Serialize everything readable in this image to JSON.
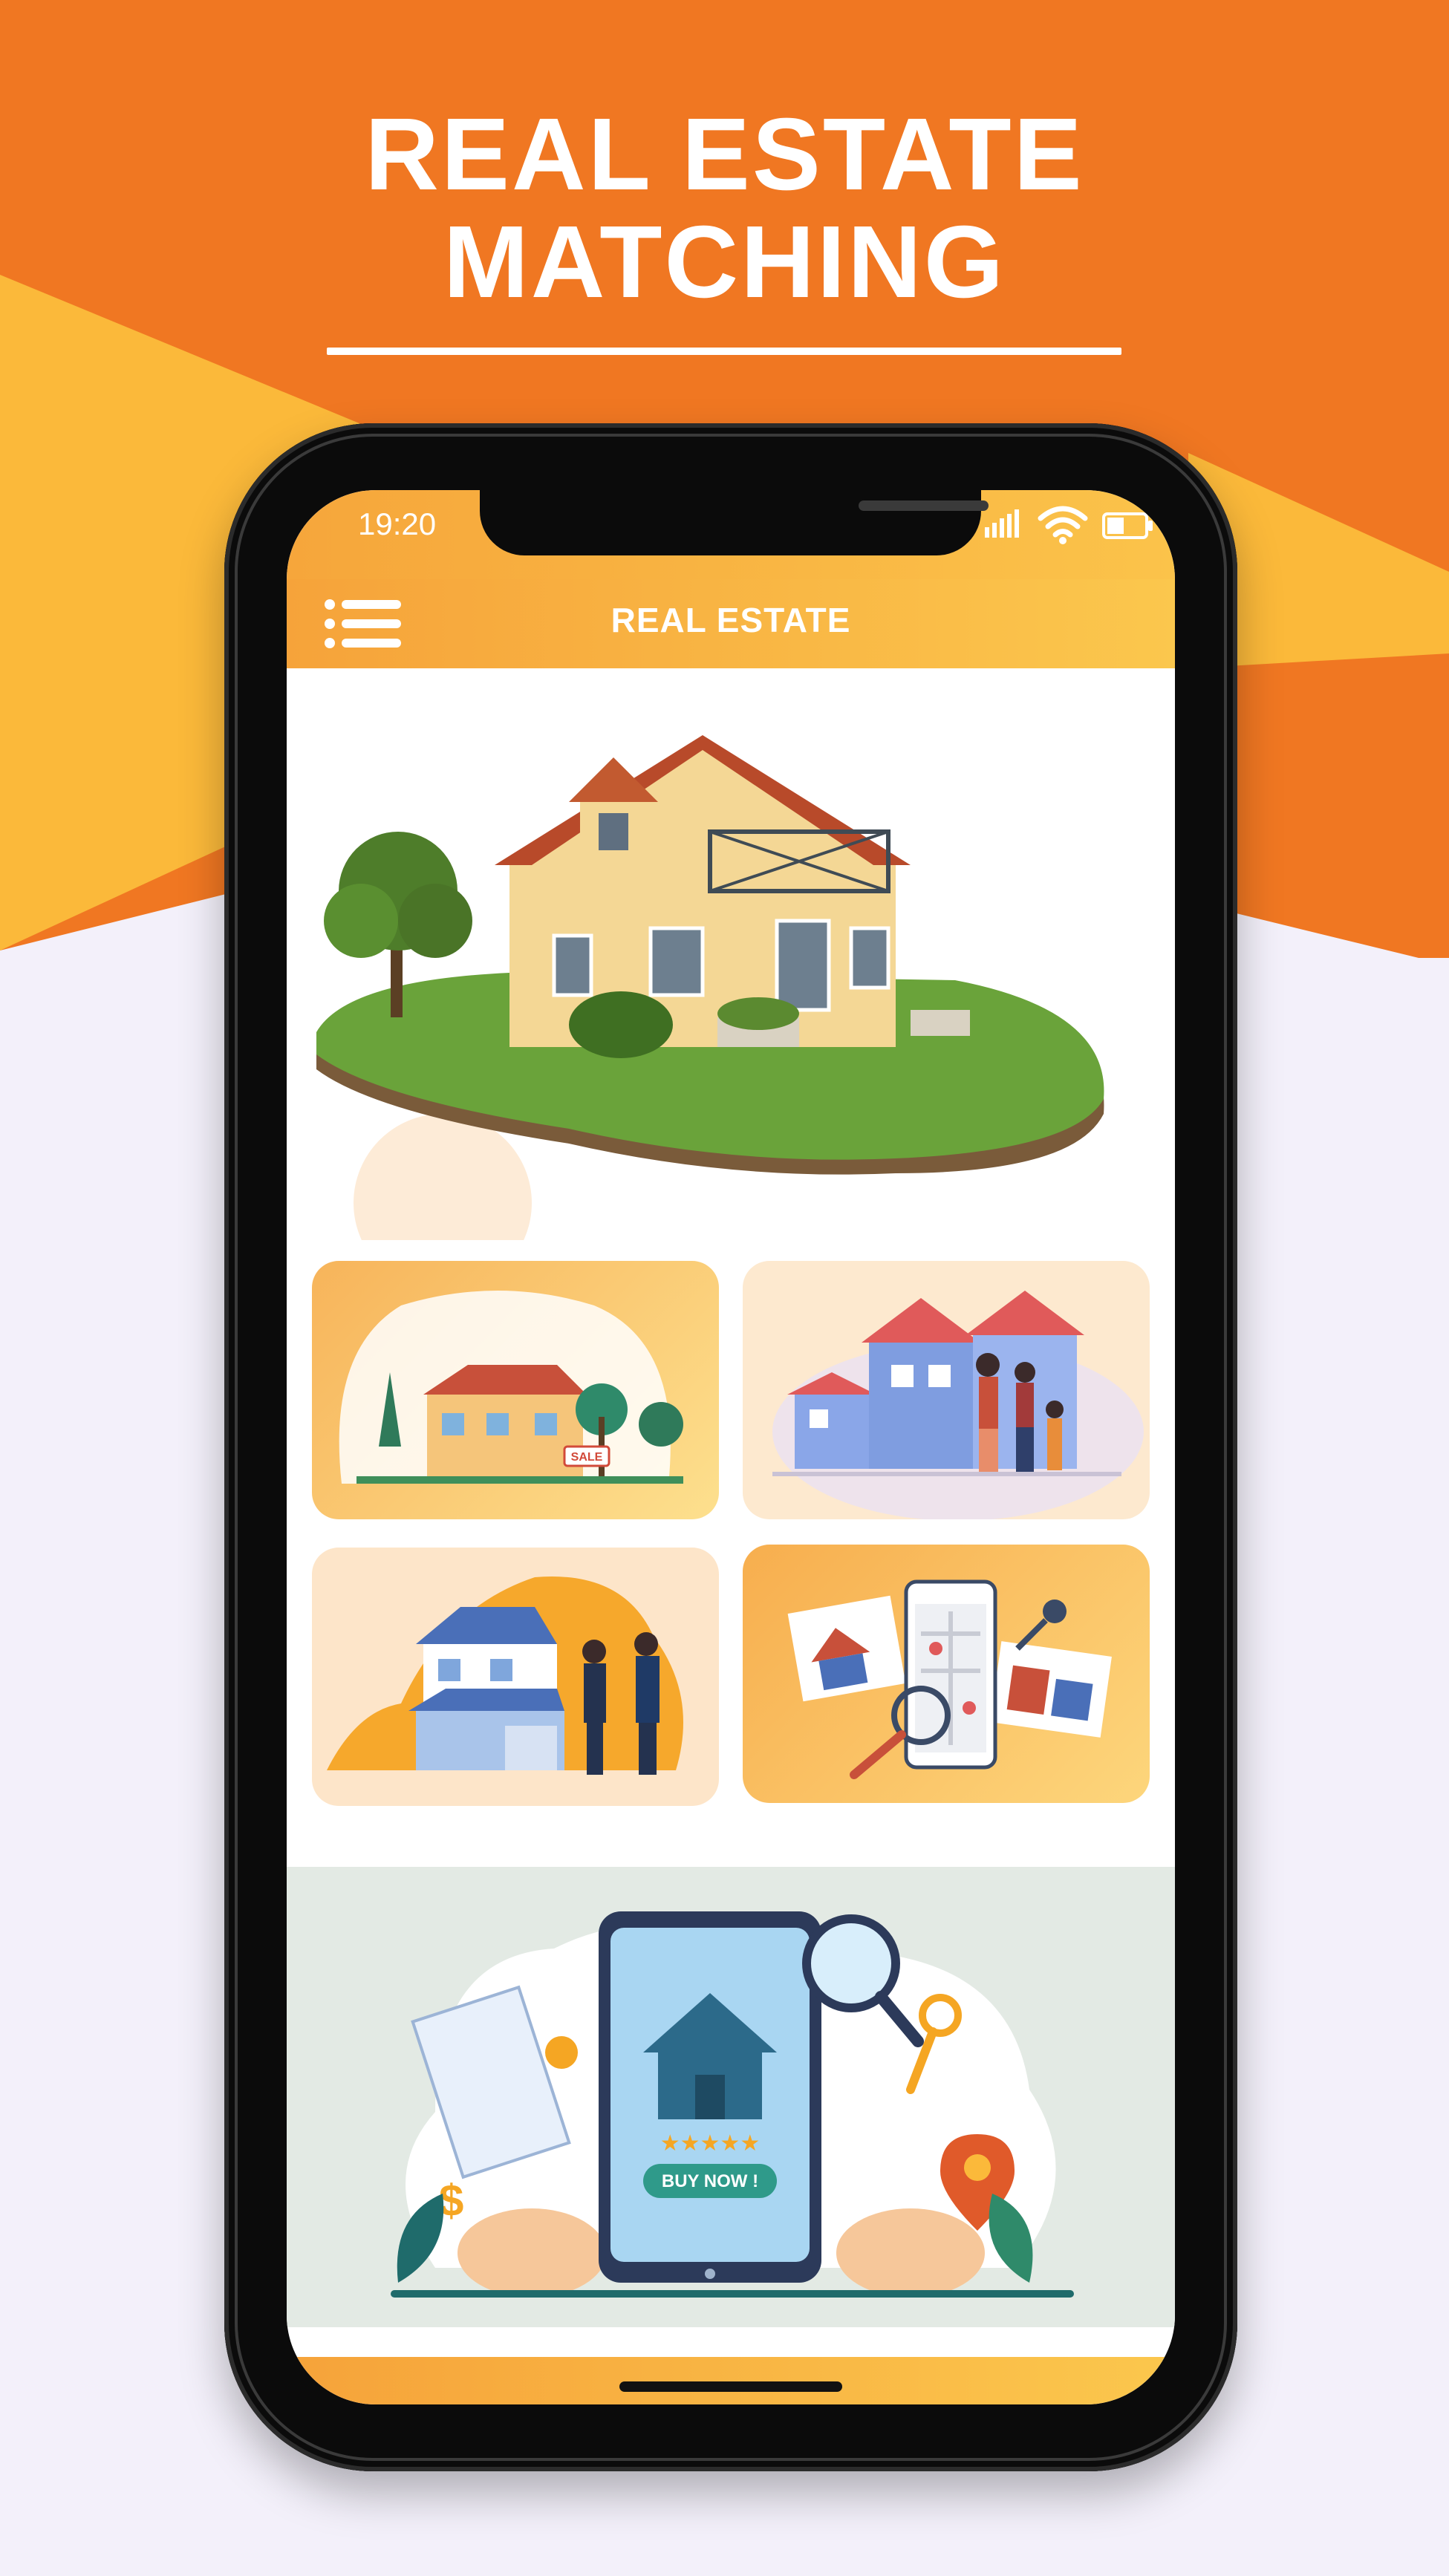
{
  "banner": {
    "line1": "REAL ESTATE",
    "line2": "MATCHING",
    "colors": {
      "orange": "#f07722",
      "yellow": "#fbb93a",
      "background": "#f3f0fa"
    }
  },
  "status_bar": {
    "time": "19:20",
    "icons": [
      "signal-icon",
      "wifi-icon",
      "battery-icon"
    ]
  },
  "app_bar": {
    "title": "REAL ESTATE",
    "menu_icon": "menu-icon"
  },
  "promo": {
    "button_label": "BUY NOW !",
    "rating_stars": 5
  },
  "cards": [
    {
      "id": "house-for-sale",
      "sign": "SALE"
    },
    {
      "id": "family-home"
    },
    {
      "id": "agent-handshake"
    },
    {
      "id": "property-search-map"
    }
  ]
}
